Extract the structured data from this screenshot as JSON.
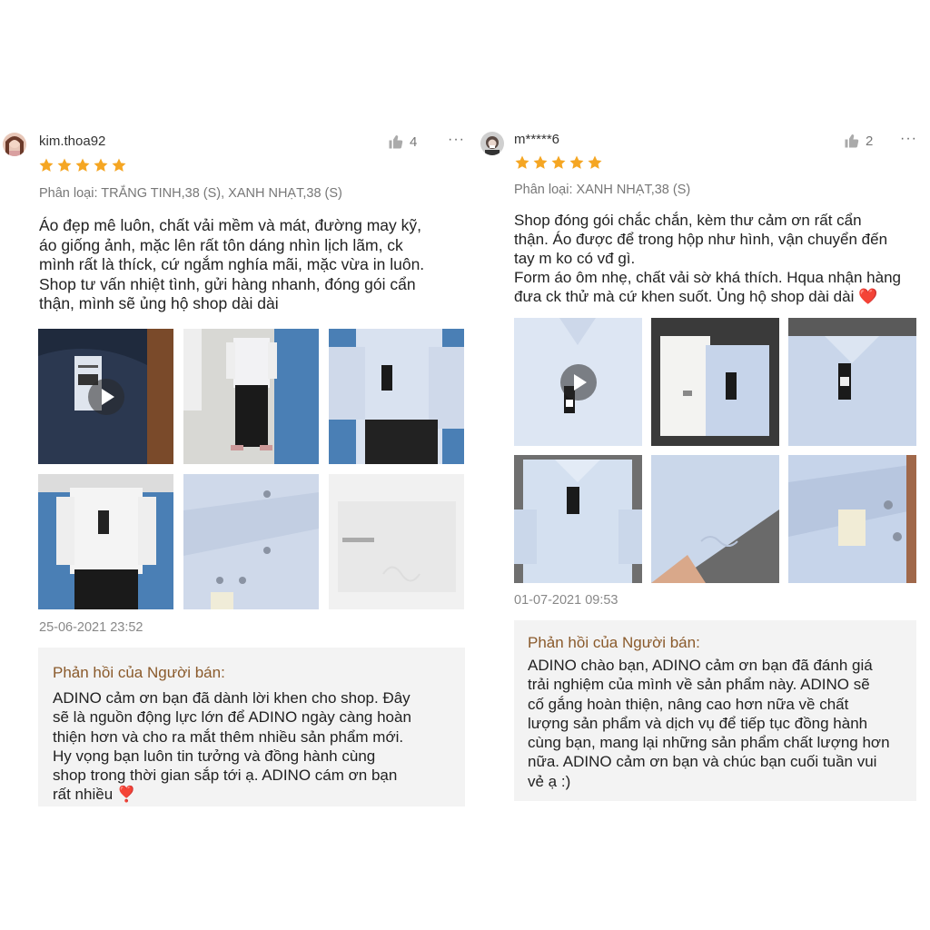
{
  "reviews": [
    {
      "username": "kim.thoa92",
      "likes": "4",
      "more": "···",
      "rating": 5,
      "variant": "Phân loại: TRẮNG TINH,38 (S), XANH NHẠT,38 (S)",
      "body_lines": [
        "Áo đẹp mê luôn, chất vải mềm và mát, đường may kỹ,",
        "áo giống ảnh, mặc lên rất tôn dáng nhìn lịch lãm, ck",
        "mình rất là thíck, cứ ngắm nghía mãi, mặc vừa in luôn.",
        "Shop tư vấn nhiệt tình, gửi hàng nhanh, đóng gói cẩn",
        "thận, mình sẽ ủng hộ shop dài dài"
      ],
      "date": "25-06-2021 23:52",
      "reply_title": "Phản hồi của Người bán:",
      "reply_lines": [
        "ADINO cảm ơn bạn đã dành lời khen cho shop. Đây",
        "sẽ là nguồn động lực lớn để ADINO ngày càng hoàn",
        "thiện hơn và cho ra mắt thêm nhiều sản phẩm mới.",
        "Hy vọng bạn luôn tin tưởng và đồng hành cùng",
        "shop trong thời gian sắp tới ạ. ADINO cám ơn bạn",
        "rất nhiều ❣️"
      ]
    },
    {
      "username": "m*****6",
      "likes": "2",
      "more": "···",
      "rating": 5,
      "variant": "Phân loại: XANH NHẠT,38 (S)",
      "body_lines": [
        "Shop đóng gói chắc chắn, kèm thư cảm ơn rất cẩn",
        "thận. Áo được để trong hộp như hình, vận chuyển đến",
        "tay m ko có vđ gì.",
        "Form áo ôm nhẹ, chất vải sờ khá thích. Hqua nhận hàng",
        "đưa ck thử mà cứ khen suốt. Ủng hộ shop dài dài ❤️"
      ],
      "date": "01-07-2021 09:53",
      "reply_title": "Phản hồi của Người bán:",
      "reply_lines": [
        "ADINO chào bạn, ADINO cảm ơn bạn đã đánh giá",
        "trải nghiệm của mình về sản phẩm này. ADINO sẽ",
        "cố gắng hoàn thiện, nâng cao hơn nữa về chất",
        "lượng sản phẩm và dịch vụ để tiếp tục đồng hành",
        "cùng bạn, mang lại những sản phẩm chất lượng hơn",
        "nữa. ADINO cảm ơn bạn và chúc bạn cuối tuần vui",
        "vẻ ạ :)"
      ]
    }
  ],
  "colors": {
    "star": "#f5a623",
    "reply_bg": "#f3f3f3",
    "reply_title": "#8a5a2b",
    "shirt_blue": "#c9d6ea",
    "curtain": "#4a7fb5"
  },
  "icons": {
    "like": "thumbs-up-icon",
    "more": "more-dots-icon",
    "star": "star-icon",
    "play": "play-icon"
  }
}
